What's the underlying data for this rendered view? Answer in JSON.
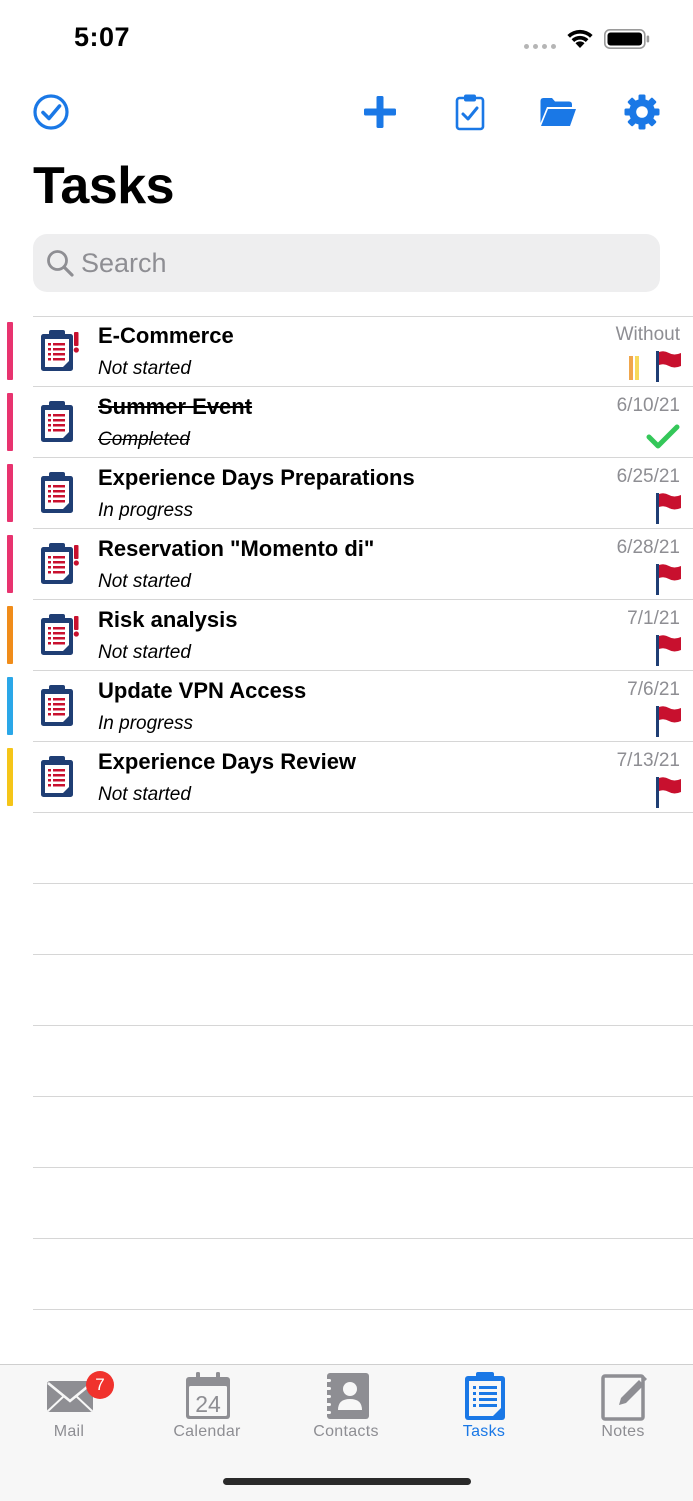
{
  "status_bar": {
    "time": "5:07"
  },
  "header": {
    "title": "Tasks",
    "icons": [
      "checkmark-circle-icon",
      "plus-icon",
      "clipboard-check-icon",
      "folder-icon",
      "gear-icon"
    ]
  },
  "search": {
    "placeholder": "Search"
  },
  "colors": {
    "accent": "#1a78e6",
    "flag": "#c8102e",
    "check": "#34c759",
    "badge": "#f0322d"
  },
  "tasks": [
    {
      "title": "E-Commerce",
      "status": "Not started",
      "date": "Without",
      "category_color": "#e8336f",
      "important": true,
      "completed": false,
      "has_priority_marker": true
    },
    {
      "title": "Summer Event",
      "status": "Completed",
      "date": "6/10/21",
      "category_color": "#e8336f",
      "important": false,
      "completed": true,
      "has_priority_marker": false
    },
    {
      "title": "Experience Days Preparations",
      "status": "In progress",
      "date": "6/25/21",
      "category_color": "#e8336f",
      "important": false,
      "completed": false,
      "has_priority_marker": false
    },
    {
      "title": "Reservation \"Momento di\"",
      "status": "Not started",
      "date": "6/28/21",
      "category_color": "#e8336f",
      "important": true,
      "completed": false,
      "has_priority_marker": false
    },
    {
      "title": "Risk analysis",
      "status": "Not started",
      "date": "7/1/21",
      "category_color": "#f08c1a",
      "important": true,
      "completed": false,
      "has_priority_marker": false
    },
    {
      "title": "Update VPN Access",
      "status": "In progress",
      "date": "7/6/21",
      "category_color": "#2aa7e8",
      "important": false,
      "completed": false,
      "has_priority_marker": false
    },
    {
      "title": "Experience Days Review",
      "status": "Not started",
      "date": "7/13/21",
      "category_color": "#f5c518",
      "important": false,
      "completed": false,
      "has_priority_marker": false
    }
  ],
  "tab_bar": {
    "tabs": [
      {
        "label": "Mail",
        "icon": "mail-icon",
        "badge": "7"
      },
      {
        "label": "Calendar",
        "icon": "calendar-icon",
        "icon_text": "24"
      },
      {
        "label": "Contacts",
        "icon": "contacts-icon"
      },
      {
        "label": "Tasks",
        "icon": "tasks-icon",
        "active": true
      },
      {
        "label": "Notes",
        "icon": "notes-icon"
      }
    ]
  }
}
